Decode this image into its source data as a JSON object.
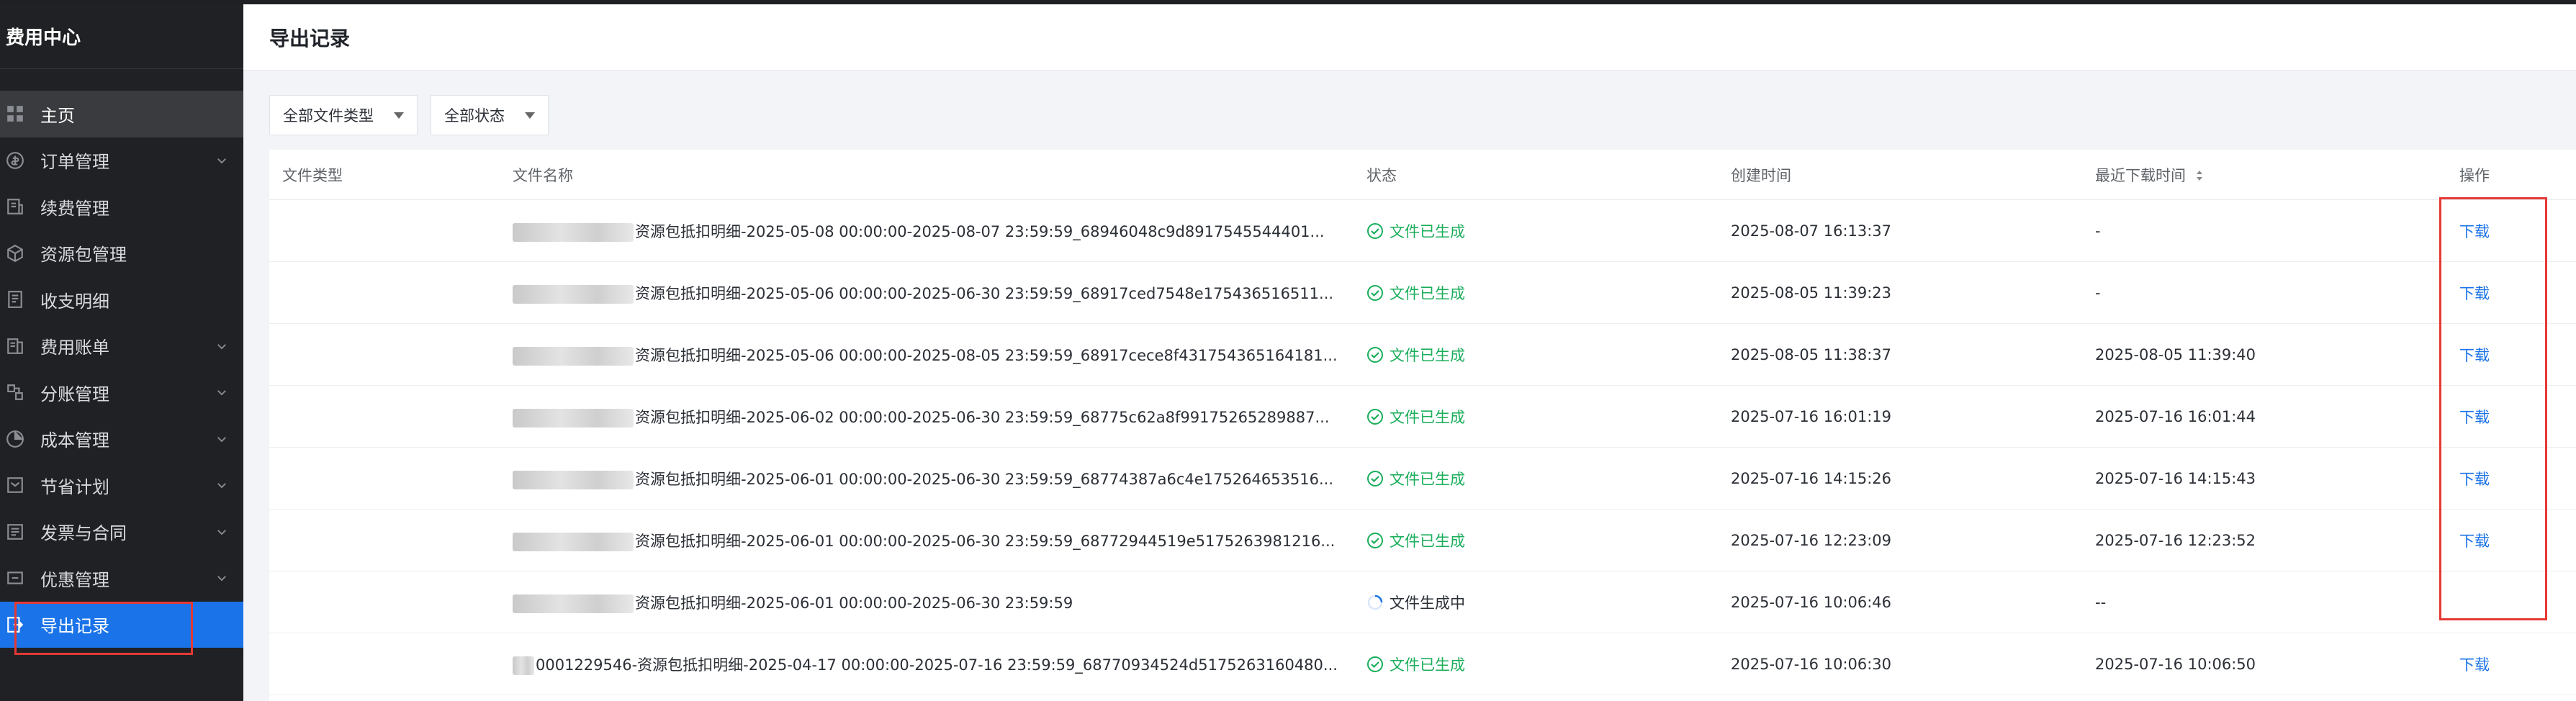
{
  "sidebar": {
    "title": "费用中心",
    "items": [
      {
        "label": "主页",
        "icon": "grid-icon",
        "chevron": false
      },
      {
        "label": "订单管理",
        "icon": "dollar-circle-icon",
        "chevron": true
      },
      {
        "label": "续费管理",
        "icon": "renew-icon",
        "chevron": false
      },
      {
        "label": "资源包管理",
        "icon": "package-icon",
        "chevron": false
      },
      {
        "label": "收支明细",
        "icon": "doc-icon",
        "chevron": false
      },
      {
        "label": "费用账单",
        "icon": "bill-icon",
        "chevron": true
      },
      {
        "label": "分账管理",
        "icon": "split-icon",
        "chevron": true
      },
      {
        "label": "成本管理",
        "icon": "pie-icon",
        "chevron": true
      },
      {
        "label": "节省计划",
        "icon": "plan-icon",
        "chevron": true
      },
      {
        "label": "发票与合同",
        "icon": "invoice-icon",
        "chevron": true
      },
      {
        "label": "优惠管理",
        "icon": "coupon-icon",
        "chevron": true
      },
      {
        "label": "导出记录",
        "icon": "export-icon",
        "chevron": false
      }
    ]
  },
  "header": {
    "title": "导出记录"
  },
  "filters": {
    "file_type": "全部文件类型",
    "status": "全部状态"
  },
  "table": {
    "columns": [
      "文件类型",
      "文件名称",
      "状态",
      "创建时间",
      "最近下载时间",
      "操作"
    ],
    "rows": [
      {
        "name": "资源包抵扣明细-2025-05-08 00:00:00-2025-08-07 23:59:59_68946048c9d8917545544401...",
        "status": "文件已生成",
        "created": "2025-08-07 16:13:37",
        "downloaded": "-",
        "op": "下载"
      },
      {
        "name": "资源包抵扣明细-2025-05-06 00:00:00-2025-06-30 23:59:59_68917ced7548e175436516511...",
        "status": "文件已生成",
        "created": "2025-08-05 11:39:23",
        "downloaded": "-",
        "op": "下载"
      },
      {
        "name": "资源包抵扣明细-2025-05-06 00:00:00-2025-08-05 23:59:59_68917cece8f431754365164181...",
        "status": "文件已生成",
        "created": "2025-08-05 11:38:37",
        "downloaded": "2025-08-05 11:39:40",
        "op": "下载"
      },
      {
        "name": "资源包抵扣明细-2025-06-02 00:00:00-2025-06-30 23:59:59_68775c62a8f99175265289887...",
        "status": "文件已生成",
        "created": "2025-07-16 16:01:19",
        "downloaded": "2025-07-16 16:01:44",
        "op": "下载"
      },
      {
        "name": "资源包抵扣明细-2025-06-01 00:00:00-2025-06-30 23:59:59_68774387a6c4e175264653516...",
        "status": "文件已生成",
        "created": "2025-07-16 14:15:26",
        "downloaded": "2025-07-16 14:15:43",
        "op": "下载"
      },
      {
        "name": "资源包抵扣明细-2025-06-01 00:00:00-2025-06-30 23:59:59_68772944519e5175263981216...",
        "status": "文件已生成",
        "created": "2025-07-16 12:23:09",
        "downloaded": "2025-07-16 12:23:52",
        "op": "下载"
      },
      {
        "name": "资源包抵扣明细-2025-06-01 00:00:00-2025-06-30 23:59:59",
        "status": "文件生成中",
        "created": "2025-07-16 10:06:46",
        "downloaded": "--",
        "op": ""
      },
      {
        "name": "0001229546-资源包抵扣明细-2025-04-17 00:00:00-2025-07-16 23:59:59_68770934524d5175263160480...",
        "status": "文件已生成",
        "created": "2025-07-16 10:06:30",
        "downloaded": "2025-07-16 10:06:50",
        "op": "下载"
      }
    ]
  },
  "colors": {
    "accent": "#1a73e8",
    "success": "#1aae5b",
    "highlight": "#e53935",
    "sidebar_bg": "#202124"
  }
}
